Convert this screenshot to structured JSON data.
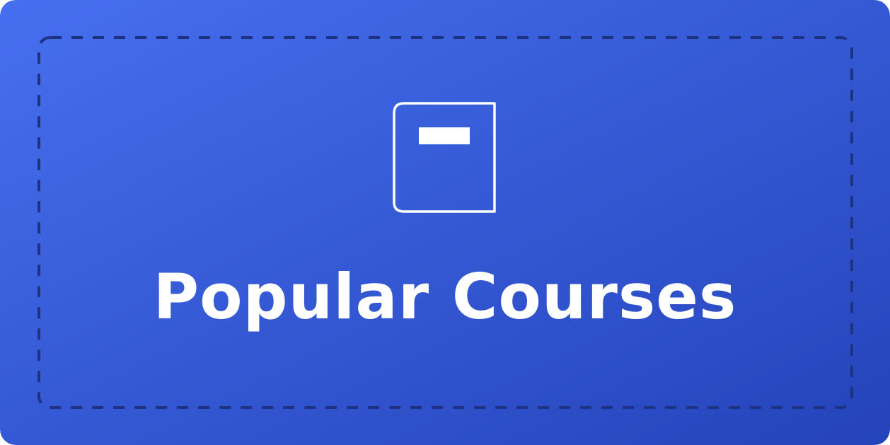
{
  "banner": {
    "title": "Popular Courses",
    "icon": "book-icon"
  },
  "colors": {
    "gradient_start": "#466FEF",
    "gradient_end": "#2443BA",
    "frame_dash": "#1F3182",
    "foreground": "#FFFFFF"
  }
}
